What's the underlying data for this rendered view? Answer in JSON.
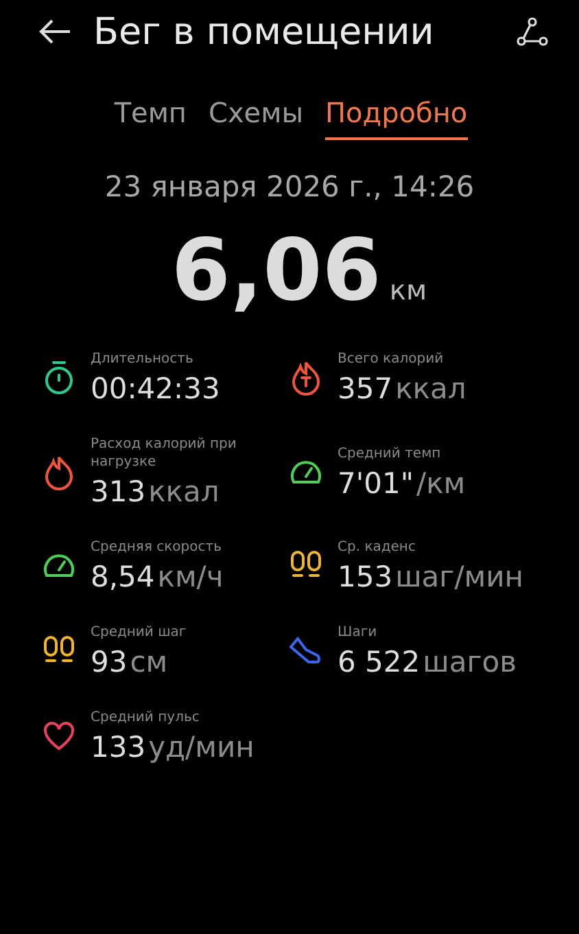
{
  "header": {
    "title": "Бег в помещении"
  },
  "tabs": [
    {
      "label": "Темп",
      "selected": false
    },
    {
      "label": "Схемы",
      "selected": false
    },
    {
      "label": "Подробно",
      "selected": true
    }
  ],
  "date": "23 января 2026 г., 14:26",
  "distance": {
    "value": "6,06",
    "unit": "км"
  },
  "metrics": [
    {
      "kind": "stopwatch",
      "color": "#2fc98e",
      "label": "Длительность",
      "value": "00:42:33"
    },
    {
      "kind": "flame-t",
      "color": "#f0553c",
      "label": "Всего калорий",
      "value": "357",
      "unit": "ккал"
    },
    {
      "kind": "flame",
      "color": "#f0553c",
      "label": "Расход калорий при нагрузке",
      "value": "313",
      "unit": "ккал"
    },
    {
      "kind": "gauge",
      "color": "#4cd05a",
      "label": "Средний темп",
      "value": "7'01\"",
      "unit": "/км"
    },
    {
      "kind": "gauge",
      "color": "#4cd05a",
      "label": "Средняя скорость",
      "value": "8,54",
      "unit": "км/ч"
    },
    {
      "kind": "footprints",
      "color": "#f1b42f",
      "label": "Ср. каденс",
      "value": "153",
      "unit": "шаг/мин"
    },
    {
      "kind": "footprints",
      "color": "#f1b42f",
      "label": "Средний шаг",
      "value": "93",
      "unit": "см"
    },
    {
      "kind": "shoe",
      "color": "#3a66f0",
      "label": "Шаги",
      "value": "6 522",
      "unit": "шагов"
    },
    {
      "kind": "heart",
      "color": "#e8415a",
      "label": "Средний пульс",
      "value": "133",
      "unit": "уд/мин"
    }
  ]
}
